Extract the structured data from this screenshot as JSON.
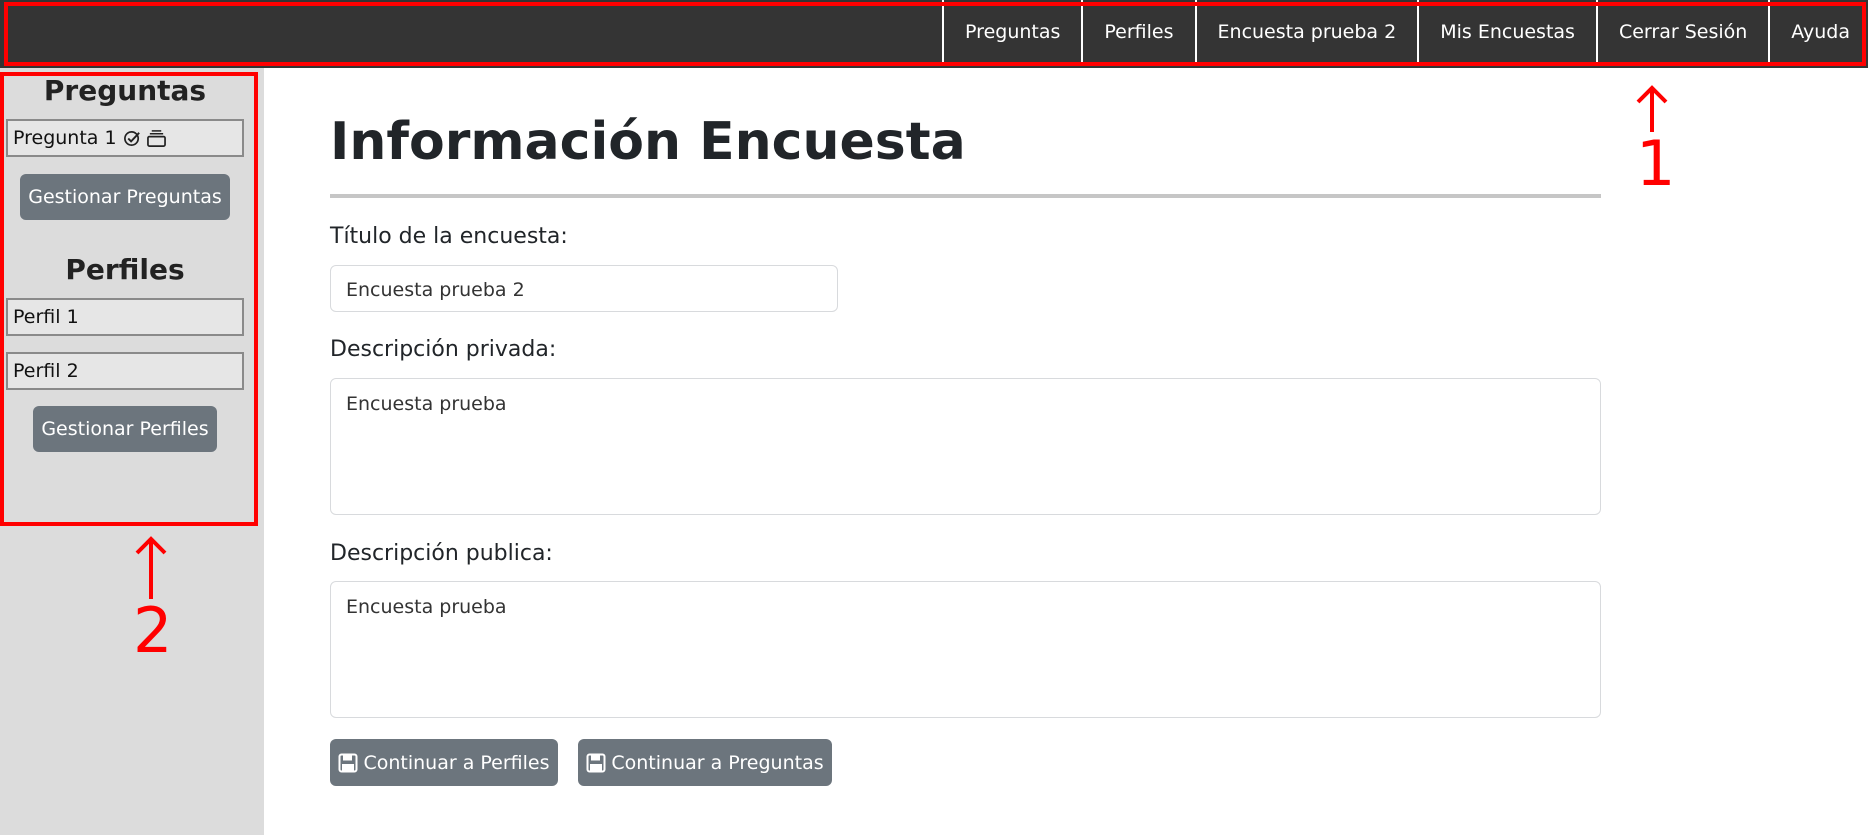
{
  "navbar": {
    "items": [
      "Preguntas",
      "Perfiles",
      "Encuesta prueba 2",
      "Mis Encuestas",
      "Cerrar Sesión",
      "Ayuda"
    ]
  },
  "annotations": {
    "label_1": "1",
    "label_2": "2",
    "color": "#ff0000"
  },
  "sidebar": {
    "questions_heading": "Preguntas",
    "questions": [
      {
        "label": "Pregunta 1",
        "icons": [
          "check-circle-icon",
          "stack-icon"
        ]
      }
    ],
    "manage_questions_label": "Gestionar Preguntas",
    "profiles_heading": "Perfiles",
    "profiles": [
      "Perfil 1",
      "Perfil 2"
    ],
    "manage_profiles_label": "Gestionar Perfiles"
  },
  "main": {
    "title": "Información Encuesta",
    "survey_title_label": "Título de la encuesta:",
    "survey_title_value": "Encuesta prueba 2",
    "private_desc_label": "Descripción privada:",
    "private_desc_value": "Encuesta prueba",
    "public_desc_label": "Descripción publica:",
    "public_desc_value": "Encuesta prueba",
    "continue_profiles_label": "Continuar a Perfiles",
    "continue_questions_label": "Continuar a Preguntas"
  },
  "colors": {
    "navbar_bg": "#343434",
    "sidebar_bg": "#dcdcdc",
    "button_gray": "#6c757d"
  }
}
